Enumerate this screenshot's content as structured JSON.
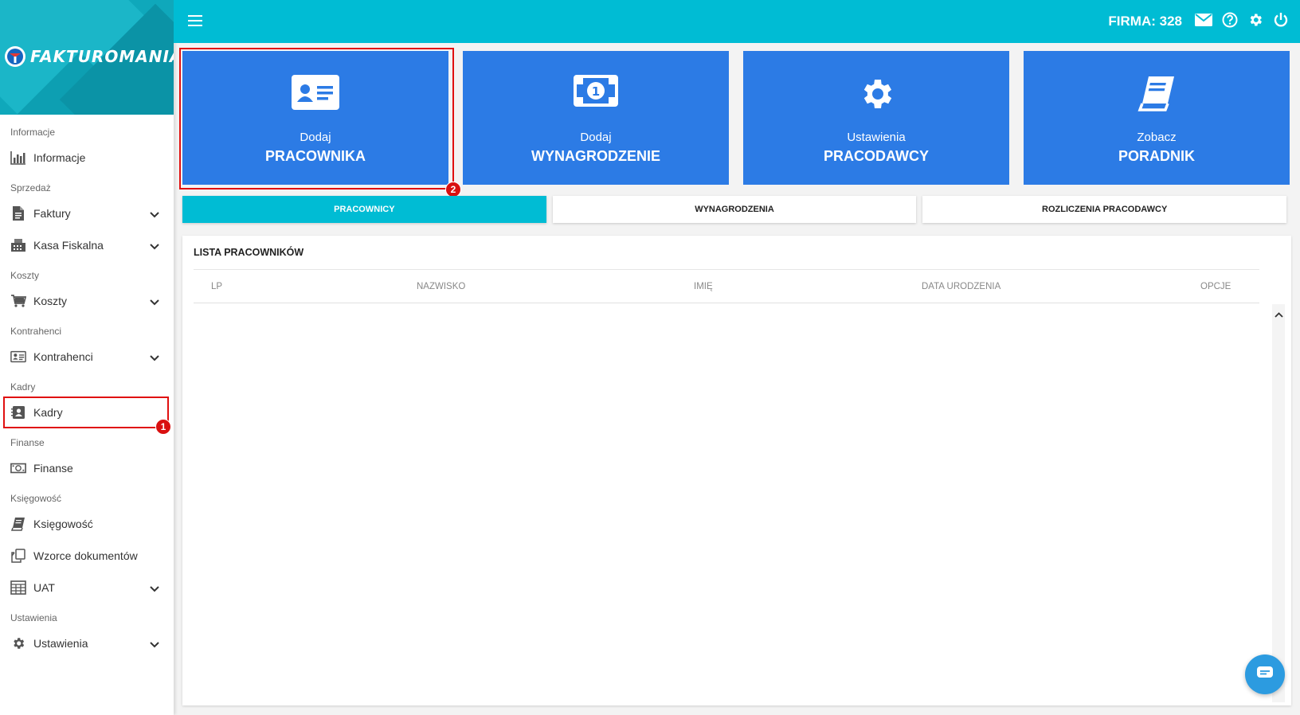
{
  "brand": {
    "name": "FAKTUROMANIA"
  },
  "topbar": {
    "firma": "FIRMA: 328"
  },
  "sidebar": {
    "items": [
      {
        "type": "section",
        "label": "Informacje"
      },
      {
        "type": "item",
        "label": "Informacje",
        "icon": "bar-chart-icon",
        "chevron": false
      },
      {
        "type": "section",
        "label": "Sprzedaż"
      },
      {
        "type": "item",
        "label": "Faktury",
        "icon": "document-icon",
        "chevron": true
      },
      {
        "type": "item",
        "label": "Kasa Fiskalna",
        "icon": "cash-register-icon",
        "chevron": true
      },
      {
        "type": "section",
        "label": "Koszty"
      },
      {
        "type": "item",
        "label": "Koszty",
        "icon": "cart-icon",
        "chevron": true
      },
      {
        "type": "section",
        "label": "Kontrahenci"
      },
      {
        "type": "item",
        "label": "Kontrahenci",
        "icon": "id-card-icon",
        "chevron": true
      },
      {
        "type": "section",
        "label": "Kadry"
      },
      {
        "type": "item",
        "label": "Kadry",
        "icon": "contact-book-icon",
        "chevron": false,
        "highlight": true
      },
      {
        "type": "section",
        "label": "Finanse"
      },
      {
        "type": "item",
        "label": "Finanse",
        "icon": "money-icon",
        "chevron": false
      },
      {
        "type": "section",
        "label": "Księgowość"
      },
      {
        "type": "item",
        "label": "Księgowość",
        "icon": "book-icon",
        "chevron": false
      },
      {
        "type": "item",
        "label": "Wzorce dokumentów",
        "icon": "copy-icon",
        "chevron": false
      },
      {
        "type": "item",
        "label": "UAT",
        "icon": "calculator-icon",
        "chevron": true
      },
      {
        "type": "section",
        "label": "Ustawienia"
      },
      {
        "type": "item",
        "label": "Ustawienia",
        "icon": "gear-icon",
        "chevron": true
      }
    ]
  },
  "tiles": [
    {
      "line1": "Dodaj",
      "line2": "PRACOWNIKA",
      "icon": "id-card-icon"
    },
    {
      "line1": "Dodaj",
      "line2": "WYNAGRODZENIE",
      "icon": "money-icon"
    },
    {
      "line1": "Ustawienia",
      "line2": "PRACODAWCY",
      "icon": "gear-icon"
    },
    {
      "line1": "Zobacz",
      "line2": "PORADNIK",
      "icon": "book-icon"
    }
  ],
  "tabs": [
    {
      "label": "PRACOWNICY",
      "active": true
    },
    {
      "label": "WYNAGRODZENIA",
      "active": false
    },
    {
      "label": "ROZLICZENIA PRACODAWCY",
      "active": false
    }
  ],
  "panel": {
    "title": "LISTA PRACOWNIKÓW",
    "columns": [
      "LP",
      "NAZWISKO",
      "IMIĘ",
      "DATA URODZENIA",
      "OPCJE"
    ]
  },
  "annotations": {
    "badge1": "1",
    "badge2": "2"
  },
  "colors": {
    "topbar": "#00bcd4",
    "tile": "#2c7be5",
    "highlight": "#e01010"
  }
}
